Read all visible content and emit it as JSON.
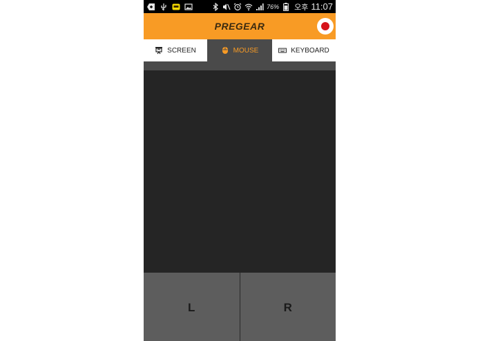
{
  "status_bar": {
    "battery_percent": "76%",
    "ampm": "오후",
    "time": "11:07",
    "icons": [
      "add-notification-icon",
      "usb-icon",
      "kakaotalk-icon",
      "image-icon",
      "bluetooth-icon",
      "mute-icon",
      "alarm-icon",
      "wifi-icon",
      "signal-icon",
      "battery-icon"
    ]
  },
  "header": {
    "title": "PREGEAR",
    "accent_color": "#f89b25",
    "record_color": "#d6141c"
  },
  "tabs": [
    {
      "label": "SCREEN",
      "icon": "screen-icon",
      "active": false
    },
    {
      "label": "MOUSE",
      "icon": "mouse-icon",
      "active": true
    },
    {
      "label": "KEYBOARD",
      "icon": "keyboard-icon",
      "active": false
    }
  ],
  "mouse_buttons": {
    "left_label": "L",
    "right_label": "R"
  }
}
